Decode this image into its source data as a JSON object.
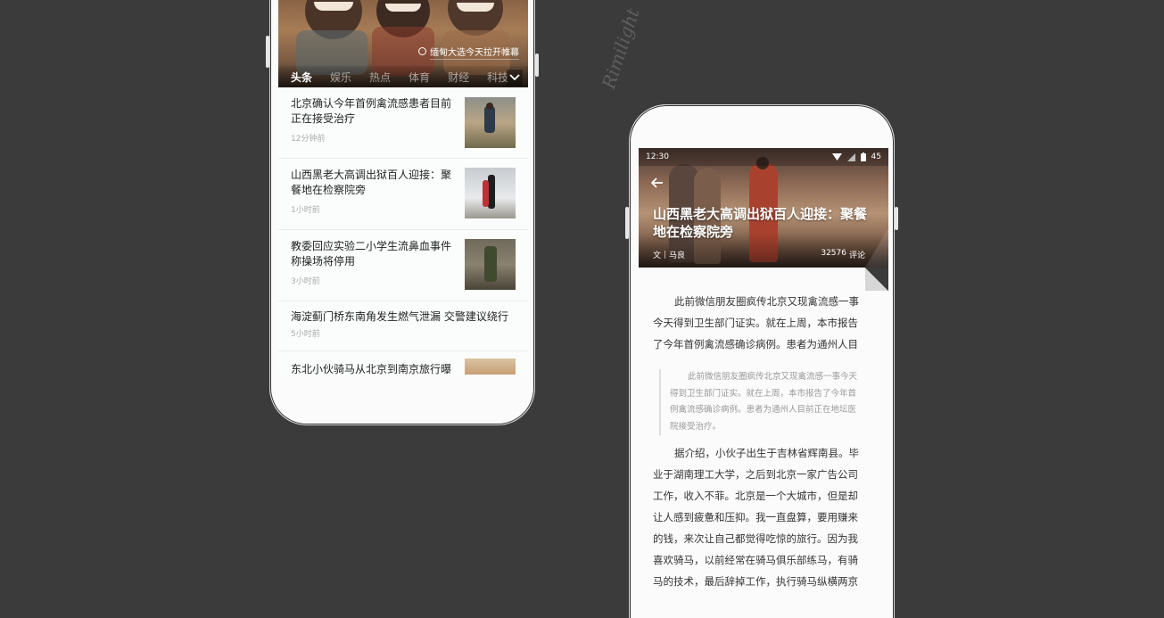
{
  "watermark": "Rimilight",
  "left_screen": {
    "hero_caption": "缅甸大选今天拉开帷幕",
    "tabs": [
      {
        "label": "头条",
        "active": true
      },
      {
        "label": "娱乐"
      },
      {
        "label": "热点"
      },
      {
        "label": "体育"
      },
      {
        "label": "财经"
      },
      {
        "label": "科技"
      }
    ],
    "news": [
      {
        "title": "北京确认今年首例禽流感患者目前正在接受治疗",
        "time": "12分钟前"
      },
      {
        "title": "山西黑老大高调出狱百人迎接：聚餐地在检察院旁",
        "time": "1小时前"
      },
      {
        "title": "教委回应实验二小学生流鼻血事件称操场将停用",
        "time": "3小时前"
      },
      {
        "title": "海淀蓟门桥东南角发生燃气泄漏 交警建议绕行",
        "time": "5小时前"
      },
      {
        "title": "东北小伙骑马从北京到南京旅行曝",
        "time": ""
      }
    ]
  },
  "right_screen": {
    "status": {
      "time": "12:30",
      "battery": "45"
    },
    "title": "山西黑老大高调出狱百人迎接：聚餐地在检察院旁",
    "byline_prefix": "文",
    "author": "马良",
    "comment_count": "32576",
    "comment_label": "评论",
    "paragraphs": [
      "此前微信朋友圈疯传北京又现禽流感一事今天得到卫生部门证实。就在上周，本市报告了今年首例禽流感确诊病例。患者为通州人目",
      "据介绍，小伙子出生于吉林省辉南县。毕业于湖南理工大学，之后到北京一家广告公司工作，收入不菲。北京是一个大城市，但是却让人感到疲惫和压抑。我一直盘算，要用赚来的钱，来次让自己都觉得吃惊的旅行。因为我喜欢骑马，以前经常在骑马俱乐部练马，有骑马的技术，最后辞掉工作，执行骑马纵横两京"
    ],
    "quote": "此前微信朋友圈疯传北京又现禽流感一事今天得到卫生部门证实。就在上周，本市报告了今年首例禽流感确诊病例。患者为通州人目前正在地坛医院接受治疗。"
  },
  "colors": {
    "accent": "#e53d30",
    "background": "#3b3b3c"
  }
}
